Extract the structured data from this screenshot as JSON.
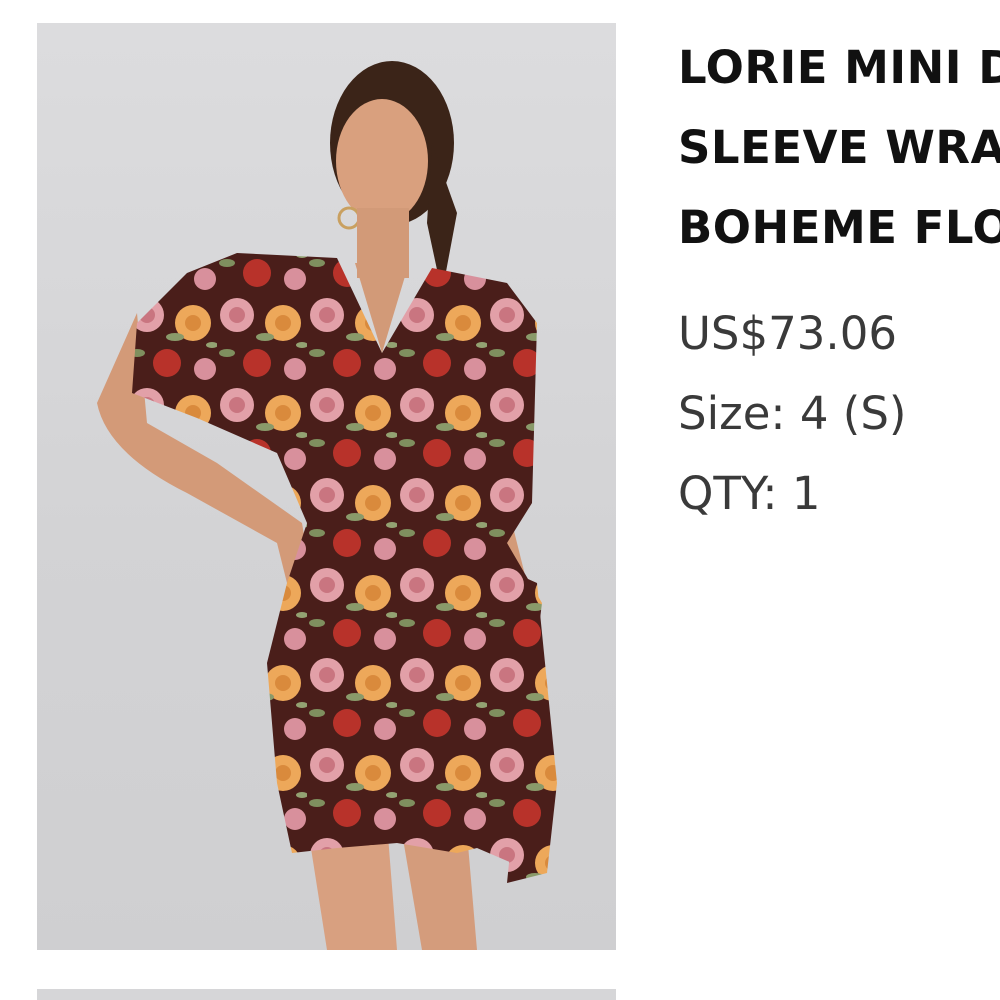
{
  "product": {
    "title_lines": [
      "LORIE MINI D",
      "SLEEVE WRA",
      "BOHEME FLO"
    ],
    "price": "US$73.06",
    "size": "Size: 4 (S)",
    "qty": "QTY: 1"
  },
  "colors": {
    "background": "#ffffff",
    "photo_backdrop": "#d6d6d8",
    "title_text": "#111111",
    "meta_text": "#3a3a3a"
  },
  "icons": {
    "product_photo": "floral-wrap-dress-photo"
  }
}
